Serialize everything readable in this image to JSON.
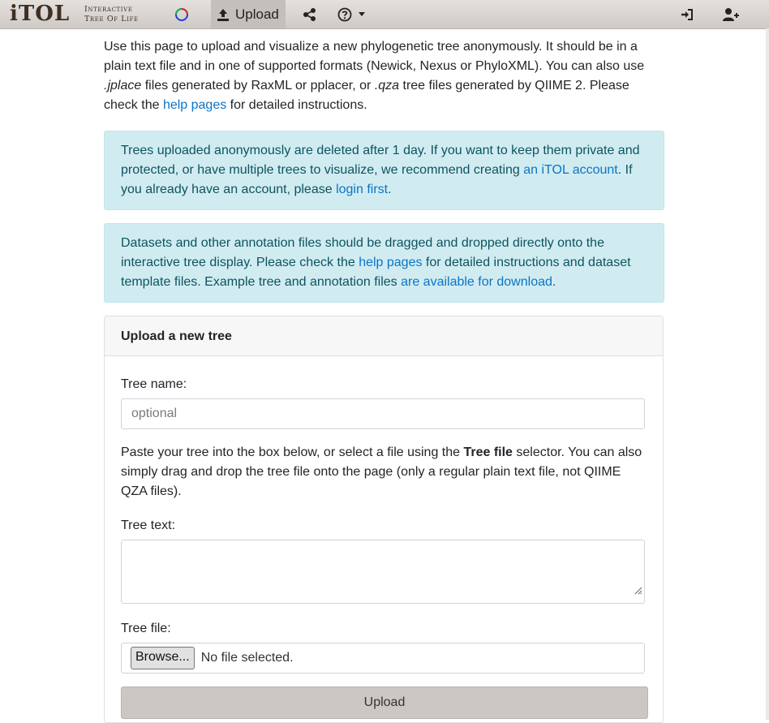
{
  "logo": {
    "main": "iTOL",
    "sub_line1": "Interactive",
    "sub_line2": "Tree Of Life"
  },
  "nav": {
    "upload_label": "Upload",
    "icons": [
      "palette-icon",
      "upload-icon",
      "share-icon",
      "help-icon",
      "chevron-down-icon",
      "login-icon",
      "register-user-icon"
    ]
  },
  "intro": {
    "t1": "Use this page to upload and visualize a new phylogenetic tree anonymously. It should be in a plain text file and in one of supported formats (Newick, Nexus or PhyloXML). You can also use ",
    "jplace": ".jplace",
    "t2": " files generated by RaxML or pplacer, or ",
    "qza": ".qza",
    "t3": " tree files generated by QIIME 2. Please check the ",
    "link": "help pages",
    "t4": " for detailed instructions."
  },
  "alert1": {
    "t1": "Trees uploaded anonymously are deleted after 1 day. If you want to keep them private and protected, or have multiple trees to visualize, we recommend creating ",
    "link1": "an iTOL account",
    "t2": ". If you already have an account, please ",
    "link2": "login first",
    "t3": "."
  },
  "alert2": {
    "t1": "Datasets and other annotation files should be dragged and dropped directly onto the interactive tree display. Please check the ",
    "link1": "help pages",
    "t2": " for detailed instructions and dataset template files. Example tree and annotation files ",
    "link2": "are available for download",
    "t3": "."
  },
  "form": {
    "header": "Upload a new tree",
    "tree_name_label": "Tree name:",
    "tree_name_placeholder": "optional",
    "paste_t1": "Paste your tree into the box below, or select a file using the ",
    "paste_bold": "Tree file",
    "paste_t2": " selector. You can also simply drag and drop the tree file onto the page (only a regular plain text file, not QIIME QZA files).",
    "tree_text_label": "Tree text:",
    "tree_file_label": "Tree file:",
    "browse_label": "Browse...",
    "file_status": "No file selected.",
    "upload_button": "Upload"
  },
  "colors": {
    "navbar_bg": "#d6d1cd",
    "alert_bg": "#d1ecf1",
    "link": "#0b74c7",
    "upload_button_bg": "#cdc7c3"
  }
}
